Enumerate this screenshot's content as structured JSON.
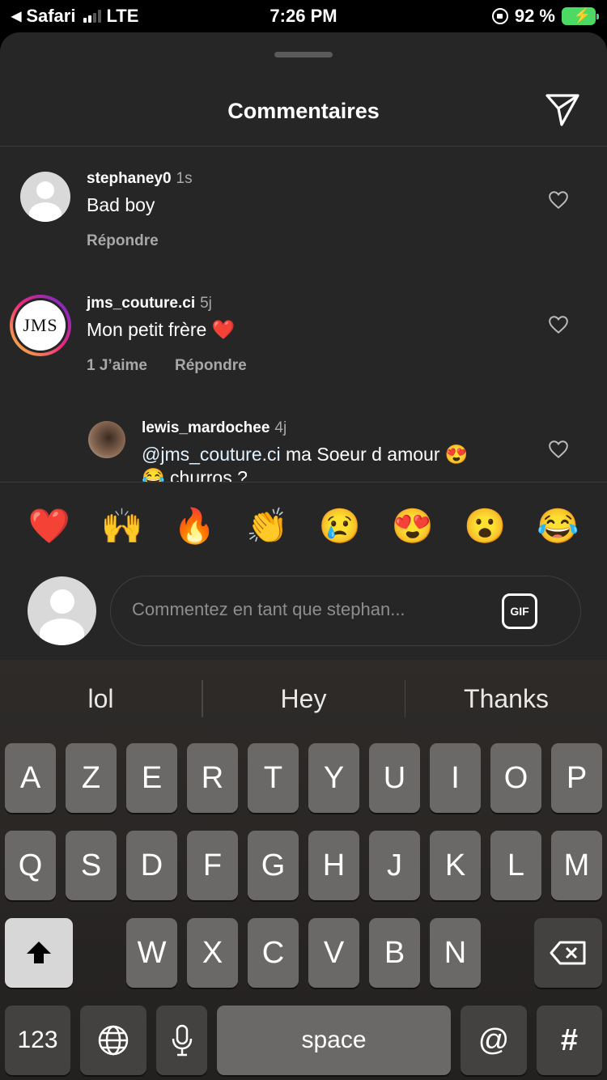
{
  "status": {
    "back_app": "Safari",
    "network": "LTE",
    "time": "7:26 PM",
    "battery": "92 %"
  },
  "sheet": {
    "title": "Commentaires"
  },
  "comments": [
    {
      "user": "stephaney0",
      "time": "1s",
      "text": "Bad boy",
      "likes": "",
      "reply": "Répondre"
    },
    {
      "user": "jms_couture.ci",
      "time": "5j",
      "text": "Mon petit frère ❤️",
      "likes": "1 J’aime",
      "reply": "Répondre",
      "avatar_text": "JMS"
    },
    {
      "user": "lewis_mardochee",
      "time": "4j",
      "mention": "@jms_couture.ci",
      "text": " ma Soeur d amour 😍",
      "text2": "😂 churros ?"
    }
  ],
  "emojis": [
    "❤️",
    "🙌",
    "🔥",
    "👏",
    "😢",
    "😍",
    "😮",
    "😂"
  ],
  "composer": {
    "placeholder": "Commentez en tant que stephan...",
    "gif": "GIF"
  },
  "keyboard": {
    "suggestions": [
      "lol",
      "Hey",
      "Thanks"
    ],
    "row1": [
      "A",
      "Z",
      "E",
      "R",
      "T",
      "Y",
      "U",
      "I",
      "O",
      "P"
    ],
    "row2": [
      "Q",
      "S",
      "D",
      "F",
      "G",
      "H",
      "J",
      "K",
      "L",
      "M"
    ],
    "row3": [
      "W",
      "X",
      "C",
      "V",
      "B",
      "N"
    ],
    "numbers": "123",
    "space": "space",
    "at": "@",
    "hash": "#"
  }
}
